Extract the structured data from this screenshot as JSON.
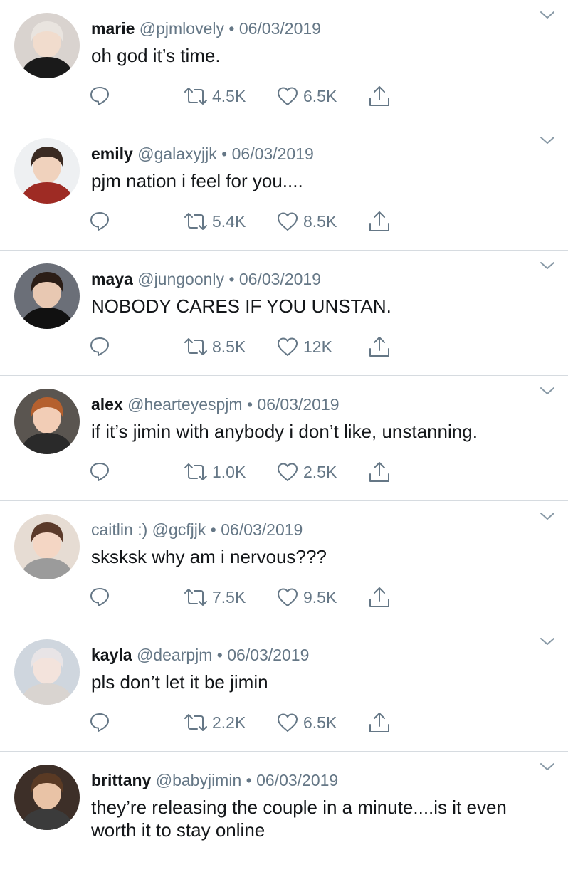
{
  "colors": {
    "text": "#14171a",
    "muted": "#657786",
    "divider": "#d6dbe0",
    "icon": "#657786"
  },
  "icons": {
    "reply": "reply-icon",
    "retweet": "retweet-icon",
    "like": "heart-icon",
    "share": "share-icon",
    "menu": "chevron-down-icon"
  },
  "tweets": [
    {
      "name": "marie",
      "handle": "@pjmlovely",
      "sep": "•",
      "date": "06/03/2019",
      "text": "oh god it’s time.",
      "retweets": "4.5K",
      "likes": "6.5K"
    },
    {
      "name": "emily",
      "handle": "@galaxyjjk",
      "sep": "•",
      "date": "06/03/2019",
      "text": "pjm nation i feel for you....",
      "retweets": "5.4K",
      "likes": "8.5K"
    },
    {
      "name": "maya",
      "handle": "@jungoonly",
      "sep": "•",
      "date": "06/03/2019",
      "text": "NOBODY CARES IF YOU UNSTAN.",
      "retweets": "8.5K",
      "likes": "12K"
    },
    {
      "name": "alex",
      "handle": "@hearteyespjm",
      "sep": "•",
      "date": "06/03/2019",
      "text": "if it’s jimin with anybody i don’t like, unstanning.",
      "retweets": "1.0K",
      "likes": "2.5K"
    },
    {
      "name": "caitlin :)",
      "handle": "@gcfjjk",
      "sep": "•",
      "date": "06/03/2019",
      "text": "sksksk why am i nervous???",
      "retweets": "7.5K",
      "likes": "9.5K"
    },
    {
      "name": "kayla",
      "handle": "@dearpjm",
      "sep": "•",
      "date": "06/03/2019",
      "text": "pls don’t let it be jimin",
      "retweets": "2.2K",
      "likes": "6.5K"
    },
    {
      "name": "brittany",
      "handle": "@babyjimin",
      "sep": "•",
      "date": "06/03/2019",
      "text": "they’re releasing the couple in a minute....is it even worth it to stay online",
      "retweets": "",
      "likes": ""
    }
  ]
}
